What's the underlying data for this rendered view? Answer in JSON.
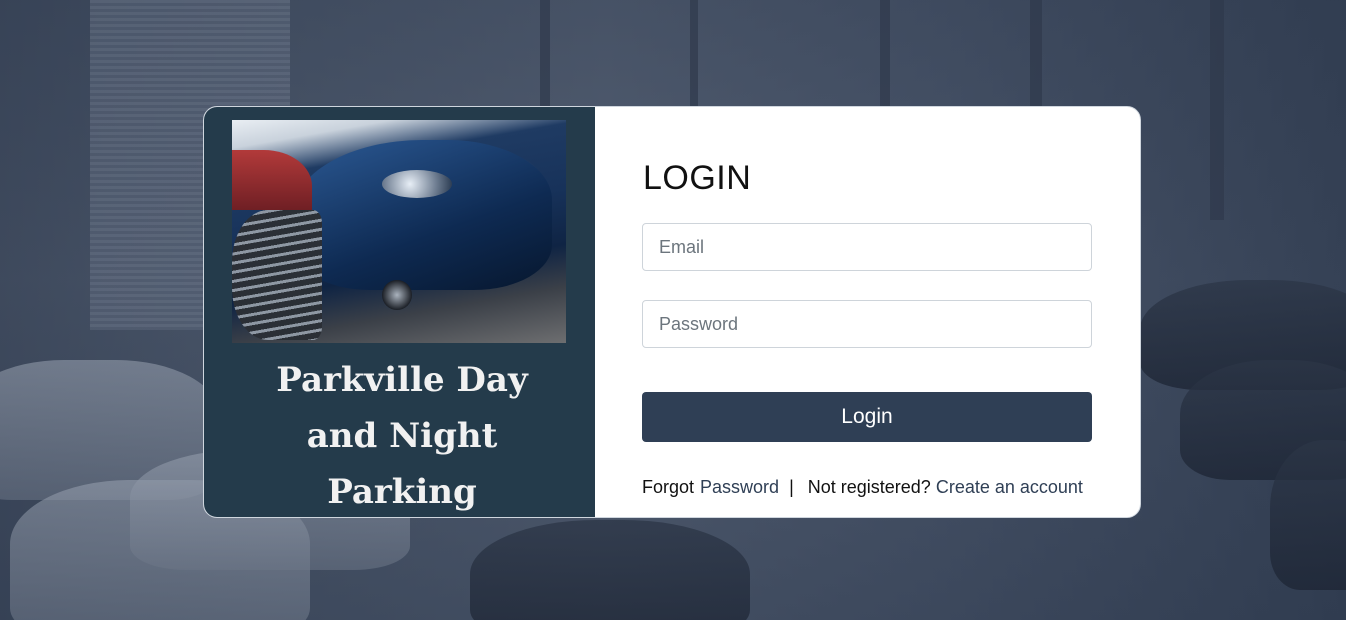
{
  "brand": {
    "title_line1": "Parkville Day",
    "title_line2": "and Night",
    "title_line3": "Parking"
  },
  "login": {
    "heading": "LOGIN",
    "email_placeholder": "Email",
    "password_placeholder": "Password",
    "submit_label": "Login"
  },
  "links": {
    "forgot_prefix": "Forgot",
    "forgot_link": "Password",
    "separator": "|",
    "not_registered": "Not registered?",
    "create_account": "Create an account"
  },
  "colors": {
    "panel": "#243b4b",
    "button": "#2f3f55"
  }
}
